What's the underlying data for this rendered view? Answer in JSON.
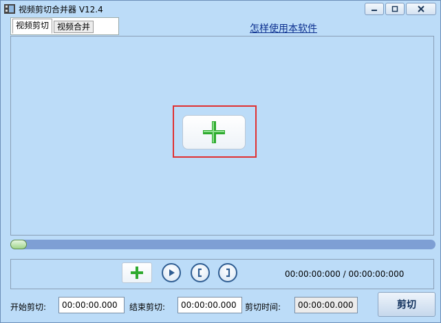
{
  "window": {
    "title": "视频剪切合并器 V12.4",
    "controls": {
      "minimize_icon": "minimize-icon",
      "maximize_icon": "maximize-icon",
      "close_icon": "close-icon"
    }
  },
  "tabs": [
    {
      "label": "视频剪切",
      "active": true
    },
    {
      "label": "视频合并",
      "active": false
    }
  ],
  "help_link": "怎样使用本软件",
  "preview": {
    "add_icon": "plus-icon"
  },
  "timeline": {
    "position": 0.0
  },
  "controls": {
    "add_icon": "plus-icon",
    "play_icon": "play-icon",
    "mark_in_icon": "bracket-left-icon",
    "mark_out_icon": "bracket-right-icon",
    "time_display": "00:00:00:000 / 00:00:00:000"
  },
  "cut_settings": {
    "start_label": "开始剪切:",
    "start_value": "00:00:00.000",
    "end_label": "结束剪切:",
    "end_value": "00:00:00.000",
    "duration_label": "剪切时间:",
    "duration_value": "00:00:00.000"
  },
  "cut_button_label": "剪切",
  "colors": {
    "background": "#bcdcf8",
    "accent_green": "#2eaa2e",
    "highlight": "#e03030",
    "link": "#0b2f8f"
  }
}
